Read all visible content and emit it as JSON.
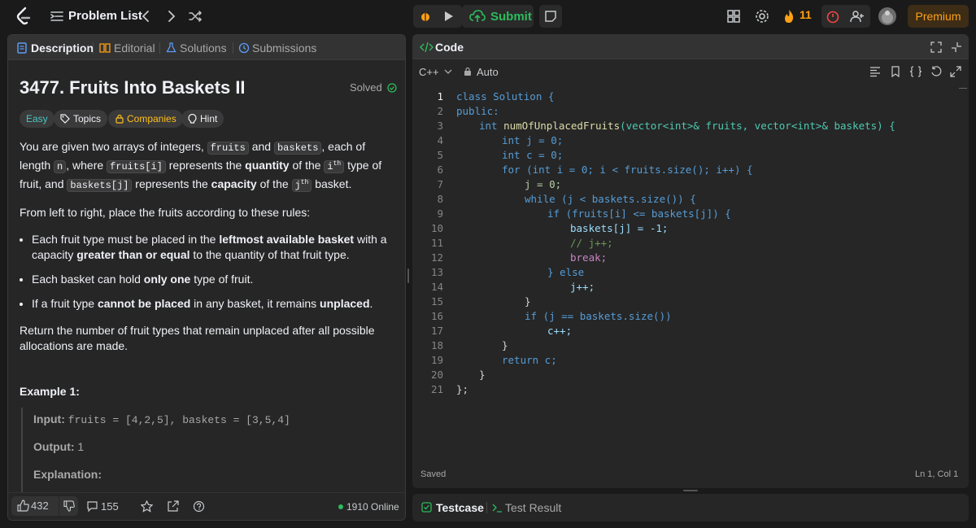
{
  "topbar": {
    "problem_list": "Problem List",
    "submit": "Submit",
    "streak": "11",
    "premium": "Premium"
  },
  "left_tabs": [
    "Description",
    "Editorial",
    "Solutions",
    "Submissions"
  ],
  "problem": {
    "title": "3477. Fruits Into Baskets II",
    "status": "Solved",
    "chips": [
      "Easy",
      "Topics",
      "Companies",
      "Hint"
    ],
    "p1": {
      "t1": "You are given two arrays of integers, ",
      "c1": "fruits",
      "t2": " and ",
      "c2": "baskets",
      "t3": ", each of length ",
      "c3": "n",
      "t4": ", where ",
      "c4": "fruits[i]",
      "t5": " represents the ",
      "b1": "quantity",
      "t6": " of the ",
      "c5": "i",
      "sup1": "th",
      "t7": " type of fruit, and ",
      "c6": "baskets[j]",
      "t8": " represents the ",
      "b2": "capacity",
      "t9": " of the ",
      "c7": "j",
      "sup2": "th",
      "t10": " basket."
    },
    "p2": "From left to right, place the fruits according to these rules:",
    "rules": [
      {
        "a": "Each fruit type must be placed in the ",
        "b": "leftmost available basket",
        "c": " with a capacity ",
        "d": "greater than or equal",
        "e": " to the quantity of that fruit type."
      },
      {
        "a": "Each basket can hold ",
        "b": "only one",
        "c": " type of fruit."
      },
      {
        "a": "If a fruit type ",
        "b": "cannot be placed",
        "c": " in any basket, it remains ",
        "d": "unplaced",
        "e": "."
      }
    ],
    "p3": "Return the number of fruit types that remain unplaced after all possible allocations are made.",
    "example_title": "Example 1:",
    "input_label": "Input:",
    "input_val": "fruits = [4,2,5], baskets = [3,5,4]",
    "output_label": "Output:",
    "output_val": "1",
    "explanation_label": "Explanation:"
  },
  "footer": {
    "likes": "432",
    "comments": "155",
    "online": "1910 Online"
  },
  "code_panel": {
    "title": "Code",
    "language": "C++",
    "auto": "Auto",
    "saved": "Saved",
    "cursor": "Ln 1, Col 1"
  },
  "code_lines": [
    "1",
    "2",
    "3",
    "4",
    "5",
    "6",
    "7",
    "8",
    "9",
    "10",
    "11",
    "12",
    "13",
    "14",
    "15",
    "16",
    "17",
    "18",
    "19",
    "20",
    "21"
  ],
  "code_text": {
    "l1": "class Solution {",
    "l2": "public:",
    "l3a": "int",
    "l3b": "numOfUnplacedFruits",
    "l3c": "(vector<int>& fruits, vector<int>& baskets) {",
    "l4": "int j = 0;",
    "l5": "int c = 0;",
    "l6": "for (int i = 0; i < fruits.size(); i++) {",
    "l7": "j = 0;",
    "l8": "while (j < baskets.size()) {",
    "l9": "if (fruits[i] <= baskets[j]) {",
    "l10": "baskets[j] = -1;",
    "l11": "// j++;",
    "l12": "break;",
    "l13": "} else",
    "l14": "j++;",
    "l15": "}",
    "l16": "if (j == baskets.size())",
    "l17": "c++;",
    "l18": "}",
    "l19": "return c;",
    "l20": "}",
    "l21": "};"
  },
  "bottom_tabs": [
    "Testcase",
    "Test Result"
  ]
}
